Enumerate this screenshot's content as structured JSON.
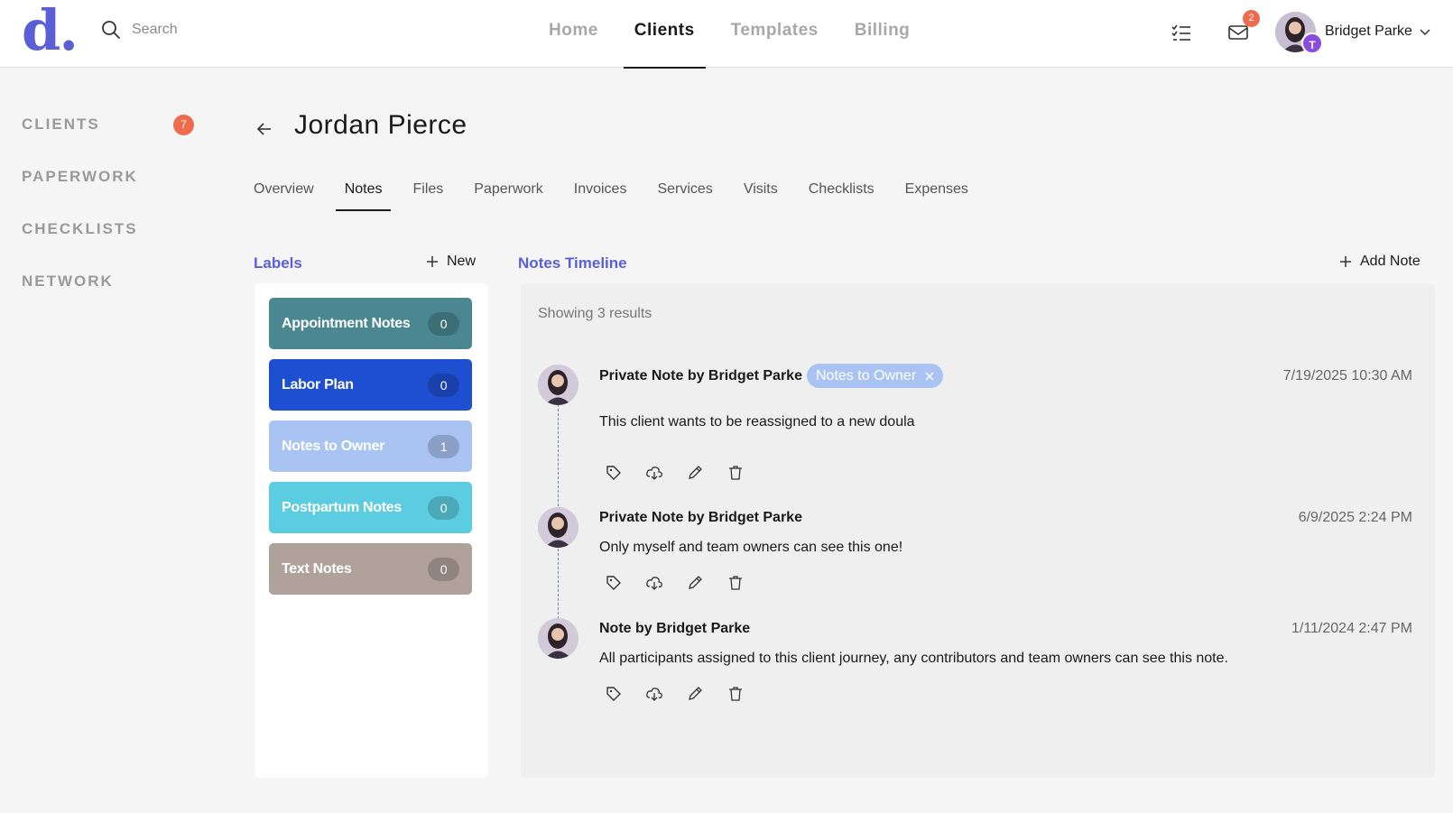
{
  "header": {
    "logo": "d.",
    "search_placeholder": "Search",
    "nav": [
      "Home",
      "Clients",
      "Templates",
      "Billing"
    ],
    "mail_badge": "2",
    "user_initial": "T",
    "user_name": "Bridget Parke"
  },
  "sidebar": {
    "items": [
      "CLIENTS",
      "PAPERWORK",
      "CHECKLISTS",
      "NETWORK"
    ],
    "clients_badge": "7"
  },
  "client": {
    "name": "Jordan Pierce",
    "tabs": [
      "Overview",
      "Notes",
      "Files",
      "Paperwork",
      "Invoices",
      "Services",
      "Visits",
      "Checklists",
      "Expenses"
    ],
    "active_tab": "Notes"
  },
  "labels": {
    "title": "Labels",
    "new_label": "New",
    "items": [
      {
        "name": "Appointment Notes",
        "count": "0",
        "color": "#4a8790"
      },
      {
        "name": "Labor Plan",
        "count": "0",
        "color": "#1f4fd1"
      },
      {
        "name": "Notes to Owner",
        "count": "1",
        "color": "#a9c4f2"
      },
      {
        "name": "Postpartum Notes",
        "count": "0",
        "color": "#5ccde0"
      },
      {
        "name": "Text Notes",
        "count": "0",
        "color": "#b0a19b"
      }
    ]
  },
  "notes": {
    "title": "Notes Timeline",
    "add_label": "Add Note",
    "showing": "Showing 3 results",
    "items": [
      {
        "author": "Private Note by Bridget Parke",
        "date": "7/19/2025 10:30 AM",
        "text": "This client wants to be reassigned to a new doula",
        "tag": "Notes to Owner"
      },
      {
        "author": "Private Note by Bridget Parke",
        "date": "6/9/2025 2:24 PM",
        "text": "Only myself and team owners can see this one!"
      },
      {
        "author": "Note by Bridget Parke",
        "date": "1/11/2024 2:47 PM",
        "text": "All participants assigned to this client journey, any contributors and team owners can see this note."
      }
    ]
  },
  "colors": {
    "accent": "#5a5fd6",
    "badge": "#ef6b4e"
  }
}
